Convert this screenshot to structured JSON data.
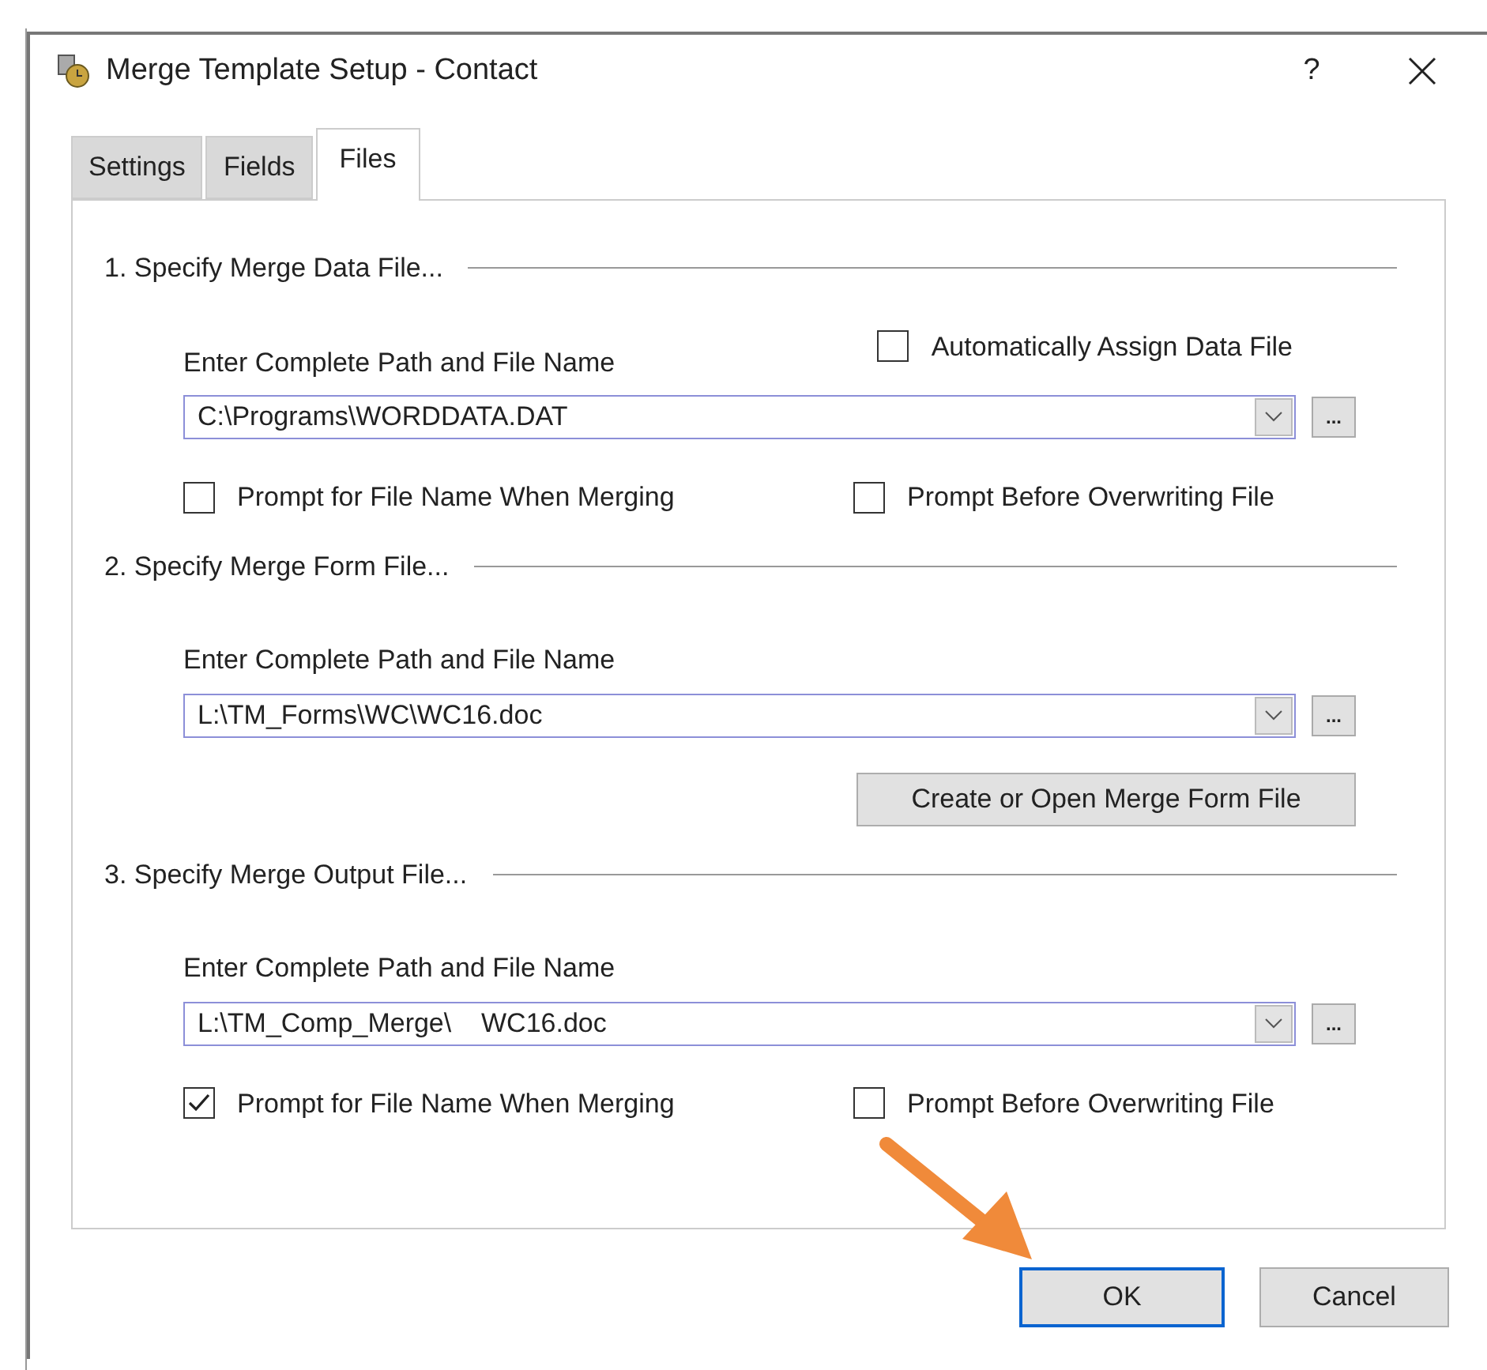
{
  "window": {
    "title": "Merge Template Setup - Contact",
    "help": "?"
  },
  "tabs": [
    {
      "label": "Settings",
      "selected": false
    },
    {
      "label": "Fields",
      "selected": false
    },
    {
      "label": "Files",
      "selected": true
    }
  ],
  "sections": [
    {
      "heading": "1. Specify Merge Data File...",
      "top_checkbox": {
        "label": "Automatically Assign Data File",
        "checked": false
      },
      "path_label": "Enter Complete Path and File Name",
      "path": "C:\\Programs\\WORDDATA.DAT",
      "browse": "...",
      "checkboxes": [
        {
          "label": "Prompt for File Name When Merging",
          "checked": false
        },
        {
          "label": "Prompt Before Overwriting File",
          "checked": false
        }
      ]
    },
    {
      "heading": "2. Specify Merge Form File...",
      "path_label": "Enter Complete Path and File Name",
      "path": "L:\\TM_Forms\\WC\\WC16.doc",
      "browse": "...",
      "button": "Create or Open Merge Form File"
    },
    {
      "heading": "3. Specify Merge Output File...",
      "path_label": "Enter Complete Path and File Name",
      "path": "L:\\TM_Comp_Merge\\    WC16.doc",
      "browse": "...",
      "checkboxes": [
        {
          "label": "Prompt for File Name When Merging",
          "checked": true
        },
        {
          "label": "Prompt Before Overwriting File",
          "checked": false
        }
      ]
    }
  ],
  "buttons": [
    {
      "label": "OK",
      "default": true
    },
    {
      "label": "Cancel",
      "default": false
    }
  ]
}
